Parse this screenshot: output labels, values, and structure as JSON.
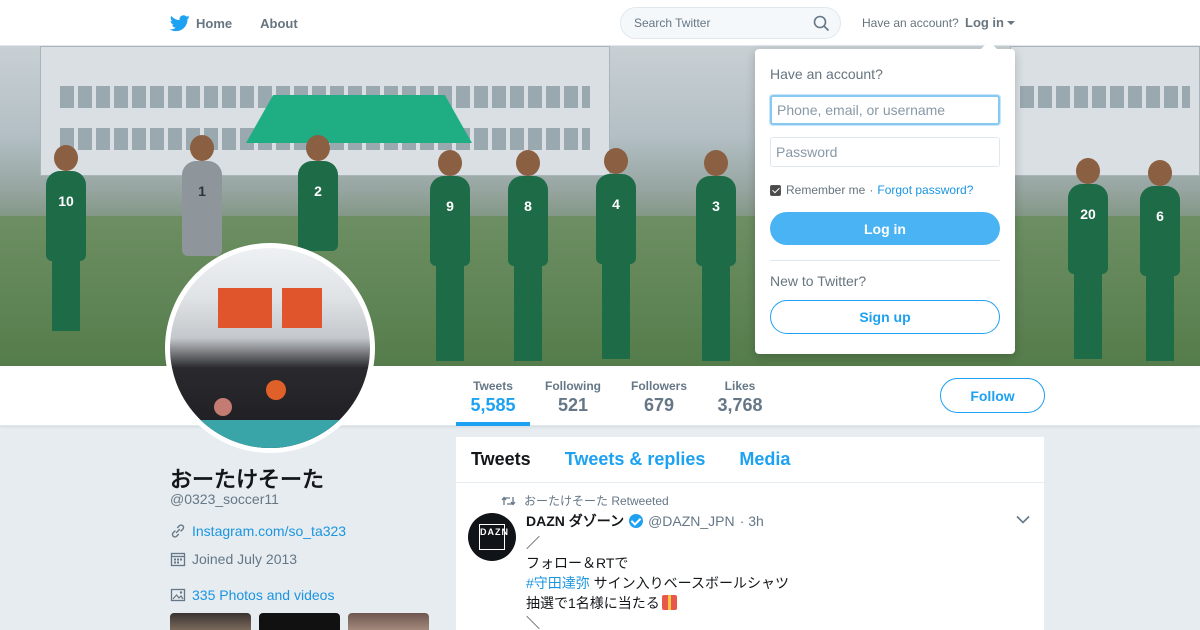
{
  "nav": {
    "home_label": "Home",
    "about_label": "About",
    "search_placeholder": "Search Twitter",
    "have_account": "Have an account?",
    "login_label": "Log in"
  },
  "stats": [
    {
      "label": "Tweets",
      "value": "5,585"
    },
    {
      "label": "Following",
      "value": "521"
    },
    {
      "label": "Followers",
      "value": "679"
    },
    {
      "label": "Likes",
      "value": "3,768"
    }
  ],
  "follow_label": "Follow",
  "profile": {
    "name": "おーたけそーた",
    "handle": "@0323_soccer11",
    "link": "Instagram.com/so_ta323",
    "joined": "Joined July 2013",
    "photos": "335 Photos and videos"
  },
  "banner": {
    "jersey_numbers": [
      "10",
      "1",
      "2",
      "9",
      "8",
      "4",
      "3",
      "20",
      "6"
    ]
  },
  "timeline": {
    "tabs": [
      "Tweets",
      "Tweets & replies",
      "Media"
    ],
    "tweet": {
      "retweeted_by": "おーたけそーた Retweeted",
      "avatar_text": "DAZN",
      "author_name": "DAZN ダゾーン",
      "author_handle": "@DAZN_JPN",
      "time": "· 3h",
      "lines": [
        "／",
        "フォロー＆RTで",
        "#守田達弥",
        " サイン入りベースボールシャツ",
        "抽選で1名様に当たる",
        "＼"
      ]
    }
  },
  "login_dropdown": {
    "title": "Have an account?",
    "username_placeholder": "Phone, email, or username",
    "password_placeholder": "Password",
    "remember_label": "Remember me",
    "separator": "·",
    "forgot_label": "Forgot password?",
    "login_button": "Log in",
    "new_to_twitter": "New to Twitter?",
    "signup_button": "Sign up"
  },
  "colors": {
    "brand": "#1da1f2",
    "login_button": "#4ab3f4",
    "page_bg": "#e6ecf0"
  }
}
